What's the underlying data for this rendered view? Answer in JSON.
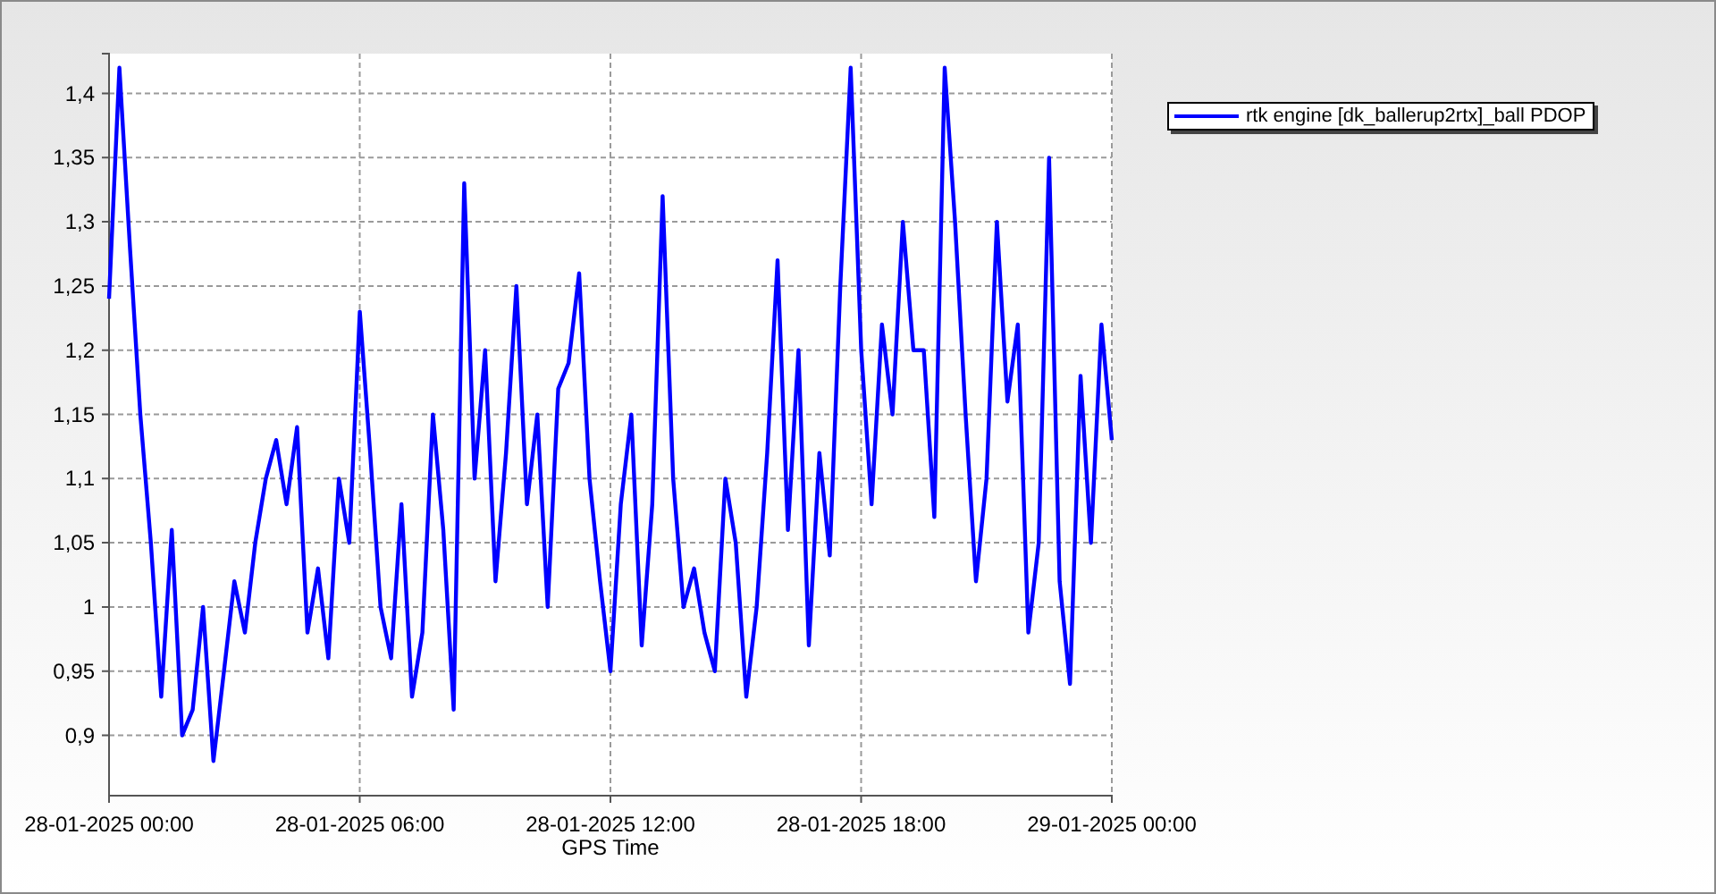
{
  "chart": {
    "chart_data": {
      "type": "line",
      "xlabel": "GPS Time",
      "grid": true,
      "categories": [
        "28-01-2025 00:00",
        null,
        null,
        null,
        null,
        null,
        null,
        null,
        null,
        null,
        null,
        null,
        null,
        null,
        null,
        null,
        null,
        null,
        null,
        null,
        null,
        null,
        null,
        null,
        "28-01-2025 06:00",
        null,
        null,
        null,
        null,
        null,
        null,
        null,
        null,
        null,
        null,
        null,
        null,
        null,
        null,
        null,
        null,
        null,
        null,
        null,
        null,
        null,
        null,
        null,
        "28-01-2025 12:00",
        null,
        null,
        null,
        null,
        null,
        null,
        null,
        null,
        null,
        null,
        null,
        null,
        null,
        null,
        null,
        null,
        null,
        null,
        null,
        null,
        null,
        null,
        null,
        "28-01-2025 18:00",
        null,
        null,
        null,
        null,
        null,
        null,
        null,
        null,
        null,
        null,
        null,
        null,
        null,
        null,
        null,
        null,
        null,
        null,
        null,
        null,
        null,
        null,
        null,
        "29-01-2025 00:00"
      ],
      "series": [
        {
          "name": "rtk engine [dk_ballerup2rtx]_ball PDOP",
          "color": "#0000ff",
          "values": [
            1.24,
            1.42,
            1.28,
            1.15,
            1.05,
            0.93,
            1.06,
            0.9,
            0.92,
            1.0,
            0.88,
            0.95,
            1.02,
            0.98,
            1.05,
            1.1,
            1.13,
            1.08,
            1.14,
            0.98,
            1.03,
            0.96,
            1.1,
            1.05,
            1.23,
            1.12,
            1.0,
            0.96,
            1.08,
            0.93,
            0.98,
            1.15,
            1.06,
            0.92,
            1.33,
            1.1,
            1.2,
            1.02,
            1.12,
            1.25,
            1.08,
            1.15,
            1.0,
            1.17,
            1.19,
            1.26,
            1.1,
            1.02,
            0.95,
            1.08,
            1.15,
            0.97,
            1.08,
            1.32,
            1.1,
            1.0,
            1.03,
            0.98,
            0.95,
            1.1,
            1.05,
            0.93,
            1.0,
            1.12,
            1.27,
            1.06,
            1.2,
            0.97,
            1.12,
            1.04,
            1.25,
            1.42,
            1.2,
            1.08,
            1.22,
            1.15,
            1.3,
            1.2,
            1.2,
            1.07,
            1.42,
            1.3,
            1.15,
            1.02,
            1.1,
            1.3,
            1.16,
            1.22,
            0.98,
            1.05,
            1.35,
            1.02,
            0.94,
            1.18,
            1.05,
            1.22,
            1.13
          ]
        }
      ],
      "ylim": [
        0.853,
        1.431
      ],
      "yticks": [
        {
          "value": 0.9,
          "label": "0,9"
        },
        {
          "value": 0.95,
          "label": "0,95"
        },
        {
          "value": 1,
          "label": "1"
        },
        {
          "value": 1.05,
          "label": "1,05"
        },
        {
          "value": 1.1,
          "label": "1,1"
        },
        {
          "value": 1.15,
          "label": "1,15"
        },
        {
          "value": 1.2,
          "label": "1,2"
        },
        {
          "value": 1.25,
          "label": "1,25"
        },
        {
          "value": 1.3,
          "label": "1,3"
        },
        {
          "value": 1.35,
          "label": "1,35"
        },
        {
          "value": 1.4,
          "label": "1,4"
        }
      ]
    }
  }
}
